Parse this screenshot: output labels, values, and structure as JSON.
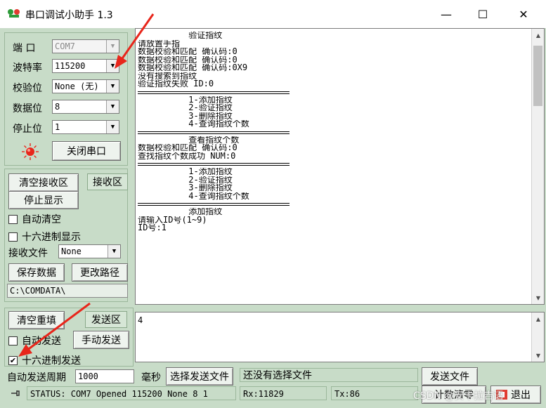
{
  "window": {
    "title": "串口调试小助手 1.3",
    "min_glyph": "—",
    "max_glyph": "☐",
    "close_glyph": "✕"
  },
  "serial": {
    "port_label": "端  口",
    "port_value": "COM7",
    "baud_label": "波特率",
    "baud_value": "115200",
    "parity_label": "校验位",
    "parity_value": "None (无)",
    "databits_label": "数据位",
    "databits_value": "8",
    "stopbits_label": "停止位",
    "stopbits_value": "1",
    "close_port_label": "关闭串口",
    "port_open": true
  },
  "receive_controls": {
    "clear_label": "清空接收区",
    "area_tag": "接收区",
    "stop_display_label": "停止显示",
    "auto_clear_label": "自动清空",
    "auto_clear_checked": false,
    "hex_display_label": "十六进制显示",
    "hex_display_checked": false,
    "recv_file_label": "接收文件",
    "recv_file_value": "None",
    "save_data_label": "保存数据",
    "change_path_label": "更改路径",
    "path_value": "C:\\COMDATA\\"
  },
  "receive_area": {
    "lines": [
      {
        "text": "          验证指纹",
        "sep": false
      },
      {
        "text": "请放置手指",
        "sep": false
      },
      {
        "text": "数据校验和匹配 确认码:0",
        "sep": false
      },
      {
        "text": "数据校验和匹配 确认码:0",
        "sep": false
      },
      {
        "text": "数据校验和匹配 确认码:0X9",
        "sep": false
      },
      {
        "text": "没有搜索到指纹",
        "sep": false
      },
      {
        "text": "验证指纹失败 ID:0",
        "sep": false
      },
      {
        "text": "",
        "sep": true
      },
      {
        "text": "          1-添加指纹",
        "sep": false
      },
      {
        "text": "          2-验证指纹",
        "sep": false
      },
      {
        "text": "          3-删除指纹",
        "sep": false
      },
      {
        "text": "          4-查询指纹个数",
        "sep": false
      },
      {
        "text": "",
        "sep": true
      },
      {
        "text": "          查看指纹个数",
        "sep": false
      },
      {
        "text": "数据校验和匹配 确认码:0",
        "sep": false
      },
      {
        "text": "查找指纹个数成功 NUM:0",
        "sep": false
      },
      {
        "text": "",
        "sep": true
      },
      {
        "text": "          1-添加指纹",
        "sep": false
      },
      {
        "text": "          2-验证指纹",
        "sep": false
      },
      {
        "text": "          3-删除指纹",
        "sep": false
      },
      {
        "text": "          4-查询指纹个数",
        "sep": false
      },
      {
        "text": "",
        "sep": true
      },
      {
        "text": "          添加指纹",
        "sep": false
      },
      {
        "text": "请输入ID号(1~9)",
        "sep": false
      },
      {
        "text": "ID号:1",
        "sep": false
      }
    ]
  },
  "send_controls": {
    "clear_label": "清空重填",
    "area_tag": "发送区",
    "auto_send_label": "自动发送",
    "auto_send_checked": false,
    "manual_send_label": "手动发送",
    "hex_send_label": "十六进制发送",
    "hex_send_checked": true,
    "send_value": "4"
  },
  "bottom": {
    "period_label": "自动发送周期",
    "period_value": "1000",
    "ms_label": "毫秒",
    "choose_file_label": "选择发送文件",
    "file_status": "还没有选择文件",
    "send_file_label": "发送文件",
    "status": "STATUS: COM7 Opened 115200 None  8 1",
    "rx": "Rx:11829",
    "tx": "Tx:86",
    "count_clear_label": "计数清零",
    "exit_label": "退出"
  },
  "watermark": "CSDN @安卡拉吉语",
  "colors": {
    "panel": "#c8dcc8",
    "indicator": "#e8261b",
    "annotation_arrow": "#e8261b"
  }
}
